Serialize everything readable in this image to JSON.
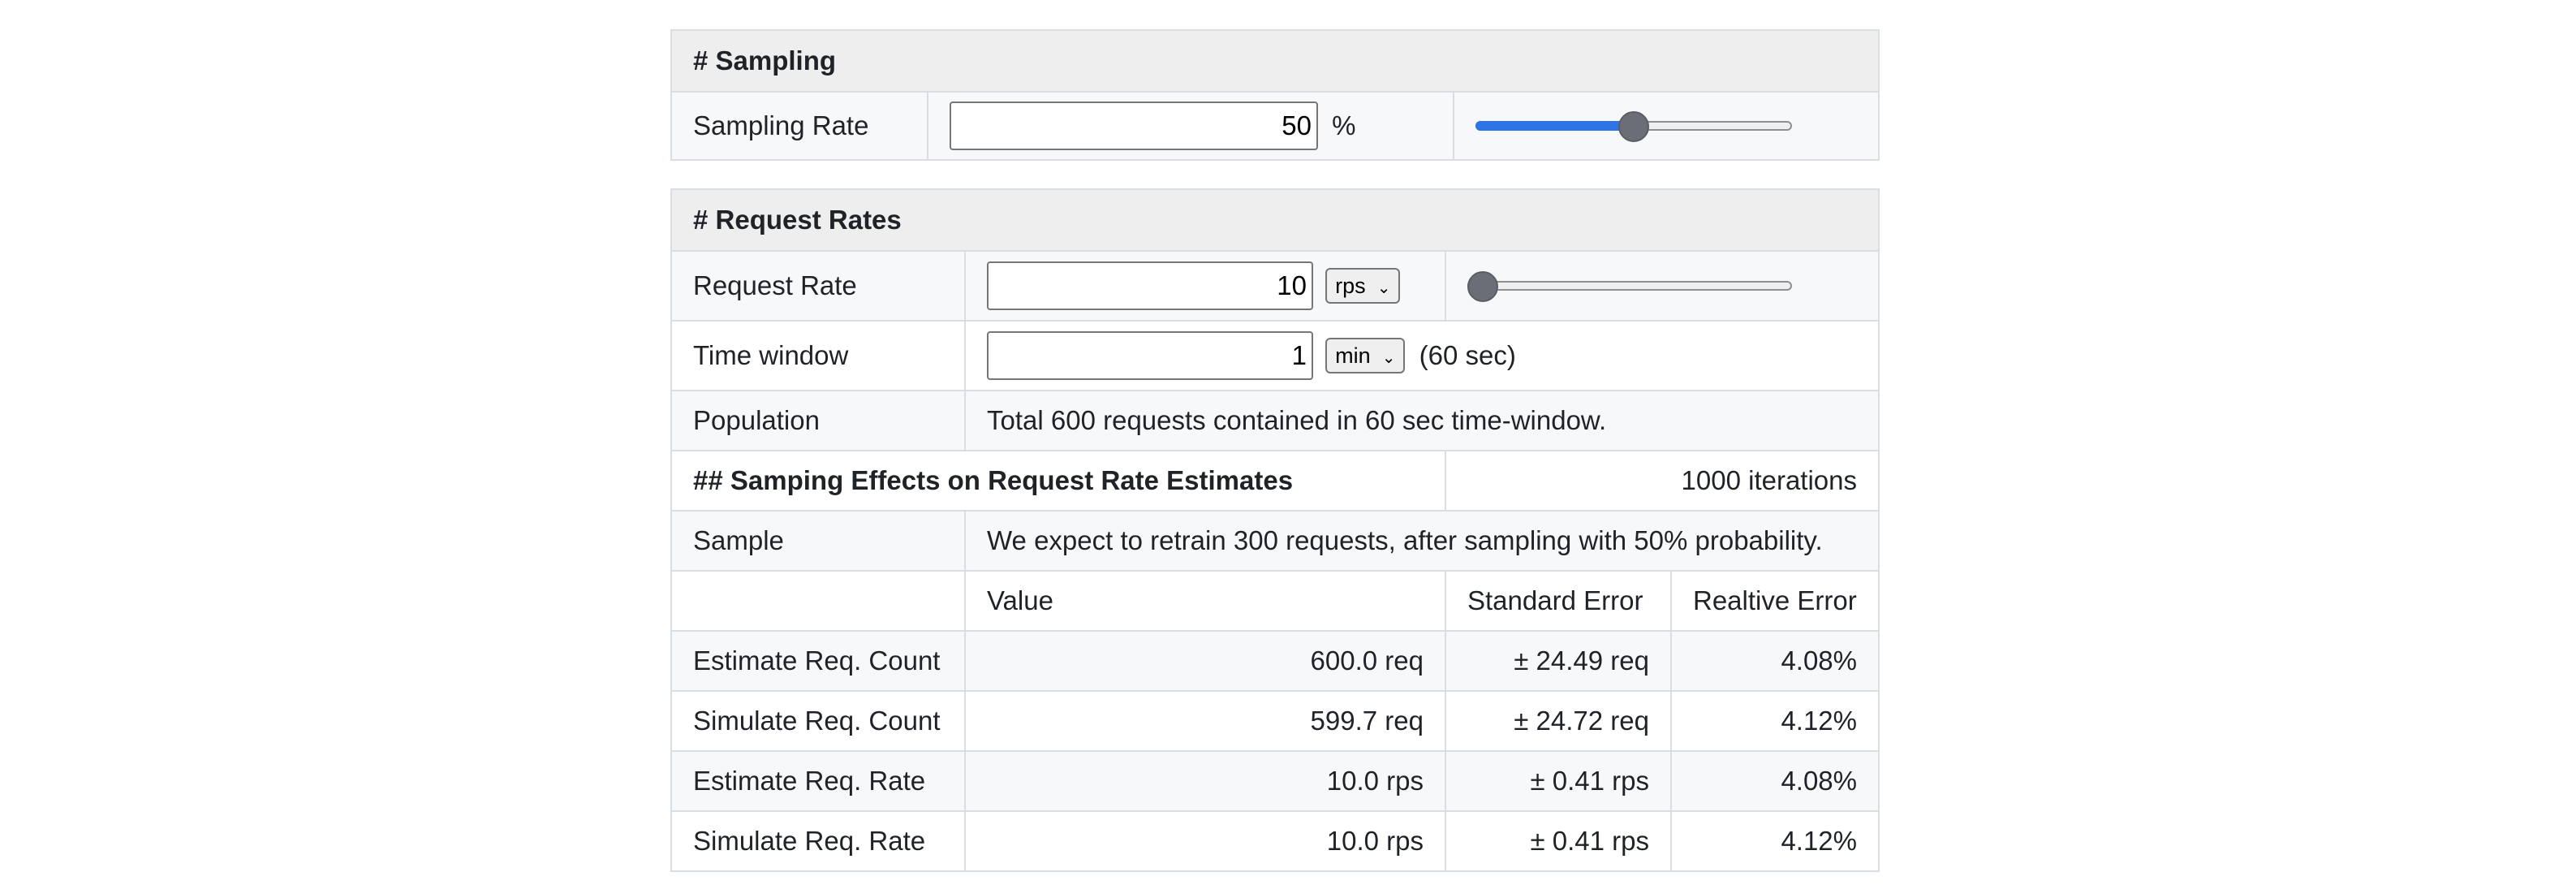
{
  "sampling": {
    "title": "# Sampling",
    "rate_label": "Sampling Rate",
    "rate_value": "50",
    "rate_unit": "%",
    "slider_fraction": 0.5
  },
  "request_rates": {
    "title": "# Request Rates",
    "rate_label": "Request Rate",
    "rate_value": "10",
    "rate_unit": "rps",
    "slider_fraction": 0.0,
    "window_label": "Time window",
    "window_value": "1",
    "window_unit": "min",
    "window_note": "(60 sec)",
    "population_label": "Population",
    "population_text": "Total 600 requests contained in 60 sec time-window."
  },
  "effects": {
    "title": "## Samping Effects on Request Rate Estimates",
    "iterations": "1000 iterations",
    "sample_label": "Sample",
    "sample_text": "We expect to retrain 300 requests, after sampling with 50% probability.",
    "columns": [
      "",
      "Value",
      "Standard Error",
      "Realtive Error"
    ],
    "rows": [
      {
        "label": "Estimate Req. Count",
        "value": "600.0 req",
        "std": "± 24.49 req",
        "rel": "4.08%"
      },
      {
        "label": "Simulate Req. Count",
        "value": "599.7 req",
        "std": "± 24.72 req",
        "rel": "4.12%"
      },
      {
        "label": "Estimate Req. Rate",
        "value": "10.0 rps",
        "std": "± 0.41 rps",
        "rel": "4.08%"
      },
      {
        "label": "Simulate Req. Rate",
        "value": "10.0 rps",
        "std": "± 0.41 rps",
        "rel": "4.12%"
      }
    ]
  }
}
